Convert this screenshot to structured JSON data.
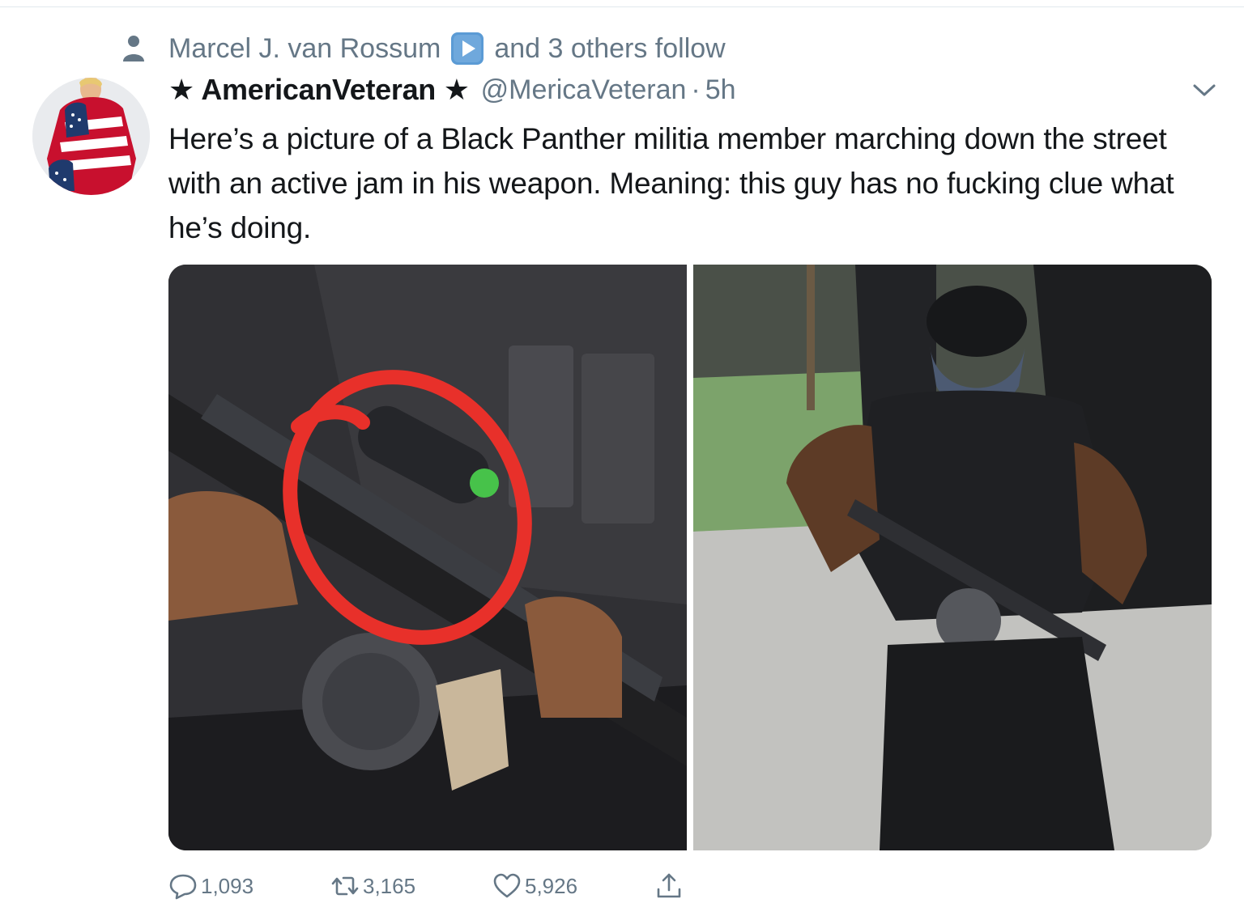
{
  "social_context": {
    "name": "Marcel J. van Rossum",
    "rest": "and 3 others follow"
  },
  "author": {
    "display_name": "★ AmericanVeteran ★",
    "handle": "@MericaVeteran",
    "separator": "·",
    "time": "5h"
  },
  "tweet": {
    "text": "Here’s a picture of a Black Panther militia member marching down the street with an active jam in his weapon. Meaning: this guy has no fucking clue what he’s doing."
  },
  "actions": {
    "replies": "1,093",
    "retweets": "3,165",
    "likes": "5,926"
  },
  "colors": {
    "text": "#14171a",
    "secondary": "#657786",
    "annotation_red": "#e8302a"
  },
  "icons": [
    "person-icon",
    "play-emoji-icon",
    "chevron-down-icon",
    "reply-icon",
    "retweet-icon",
    "like-icon",
    "share-icon"
  ]
}
